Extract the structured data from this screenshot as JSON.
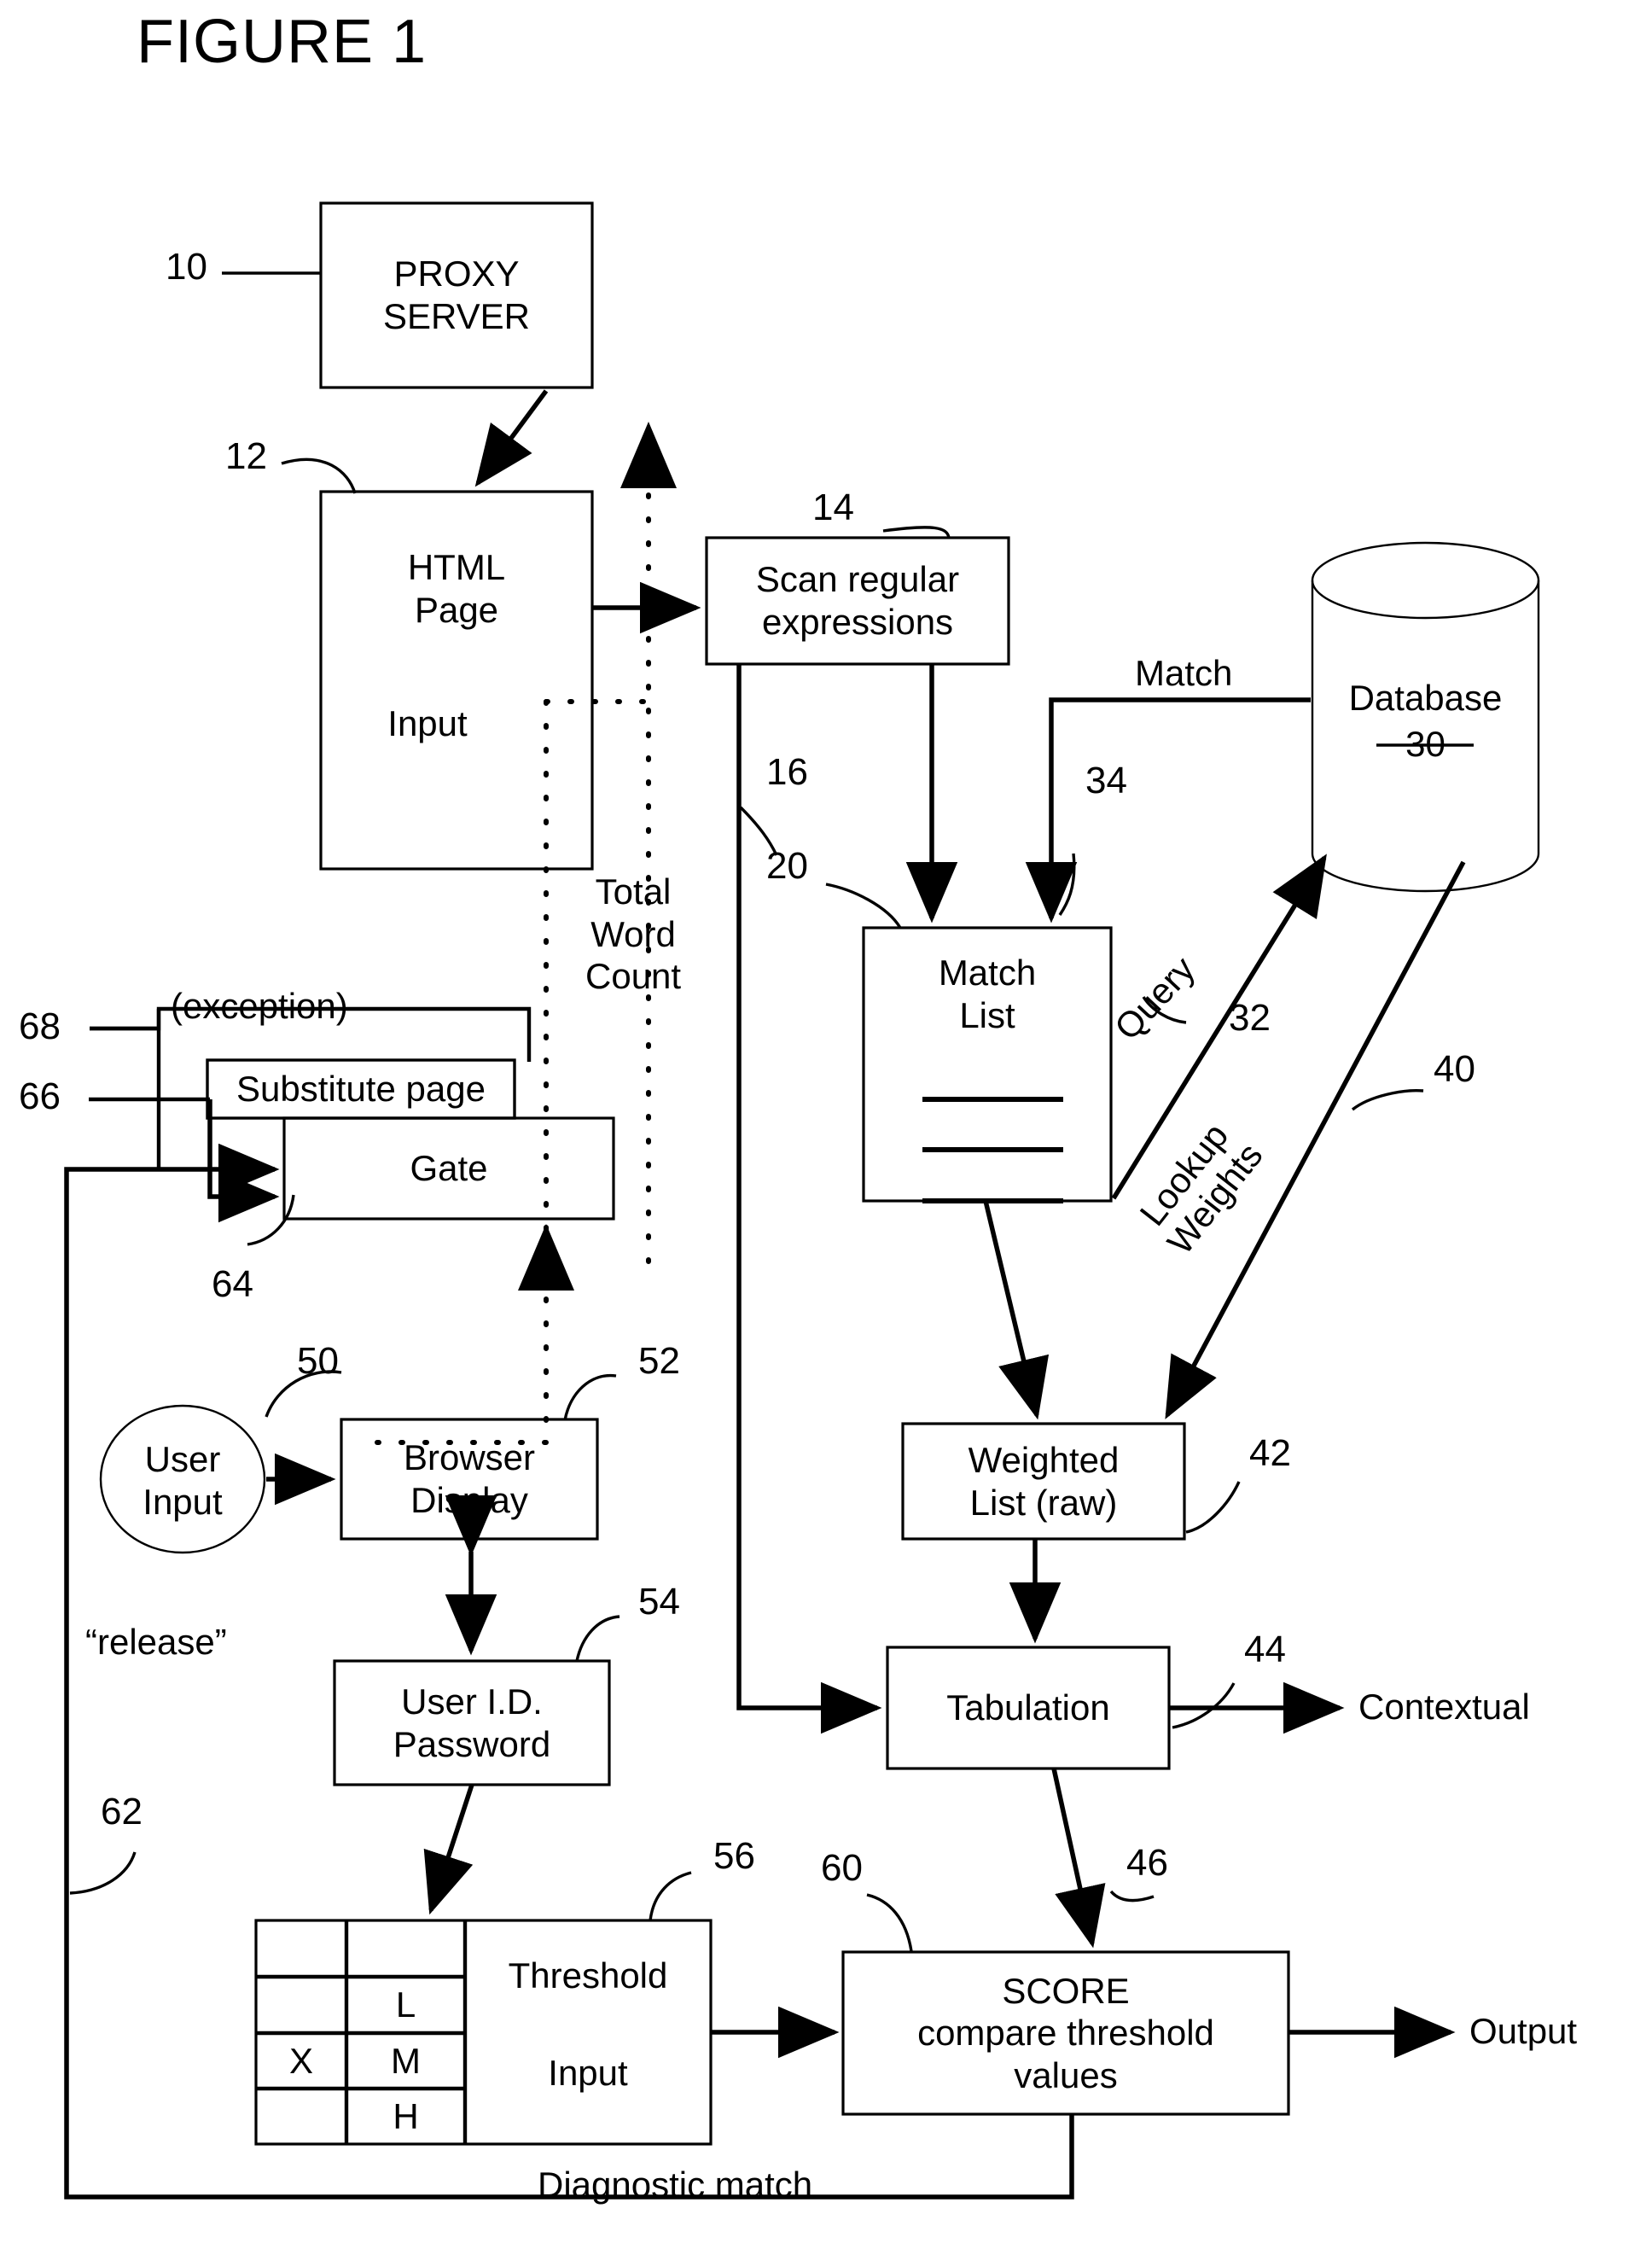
{
  "figure": {
    "title": "FIGURE 1",
    "type": "patent-flow-diagram"
  },
  "nodes": {
    "proxy_server": {
      "label": "PROXY\nSERVER",
      "ref": "10"
    },
    "html_page": {
      "label": "HTML\nPage",
      "sublabel": "Input",
      "ref": "12"
    },
    "scan_regex": {
      "label": "Scan regular\nexpressions",
      "ref": "14"
    },
    "match_list": {
      "label": "Match\nList",
      "ref": "20"
    },
    "database": {
      "label": "Database",
      "ref": "30"
    },
    "weighted_list": {
      "label": "Weighted\nList (raw)",
      "ref": "42"
    },
    "tabulation": {
      "label": "Tabulation",
      "ref": "44"
    },
    "score": {
      "label": "SCORE\ncompare threshold\nvalues",
      "ref": "60"
    },
    "substitute_page": {
      "label": "Substitute page",
      "ref": "66"
    },
    "gate": {
      "label": "Gate",
      "ref": "64"
    },
    "user_input": {
      "label": "User\nInput",
      "ref": "50"
    },
    "browser_display": {
      "label": "Browser\nDisplay",
      "ref": "52"
    },
    "user_id_password": {
      "label": "User I.D.\nPassword",
      "ref": "54"
    },
    "threshold": {
      "label": "Threshold",
      "sublabel": "Input",
      "ref": "56"
    }
  },
  "edge_labels": {
    "total_word_count": "Total\nWord\nCount",
    "match": "Match",
    "query": "Query",
    "lookup_weights": "Lookup\nWeights",
    "exception": "(exception)",
    "release": "“release”",
    "diagnostic_match": "Diagnostic match",
    "contextual": "Contextual",
    "output": "Output"
  },
  "reference_numerals": {
    "n10": "10",
    "n12": "12",
    "n14": "14",
    "n16": "16",
    "n20": "20",
    "n30": "30",
    "n32": "32",
    "n34": "34",
    "n40": "40",
    "n42": "42",
    "n44": "44",
    "n46": "46",
    "n50": "50",
    "n52": "52",
    "n54": "54",
    "n56": "56",
    "n60": "60",
    "n62": "62",
    "n64": "64",
    "n66": "66",
    "n68": "68"
  },
  "threshold_table": {
    "rows": [
      {
        "mark": "",
        "level": ""
      },
      {
        "mark": "",
        "level": "L"
      },
      {
        "mark": "X",
        "level": "M"
      },
      {
        "mark": "",
        "level": "H"
      }
    ]
  },
  "colors": {
    "stroke": "#000000",
    "background": "#ffffff"
  }
}
